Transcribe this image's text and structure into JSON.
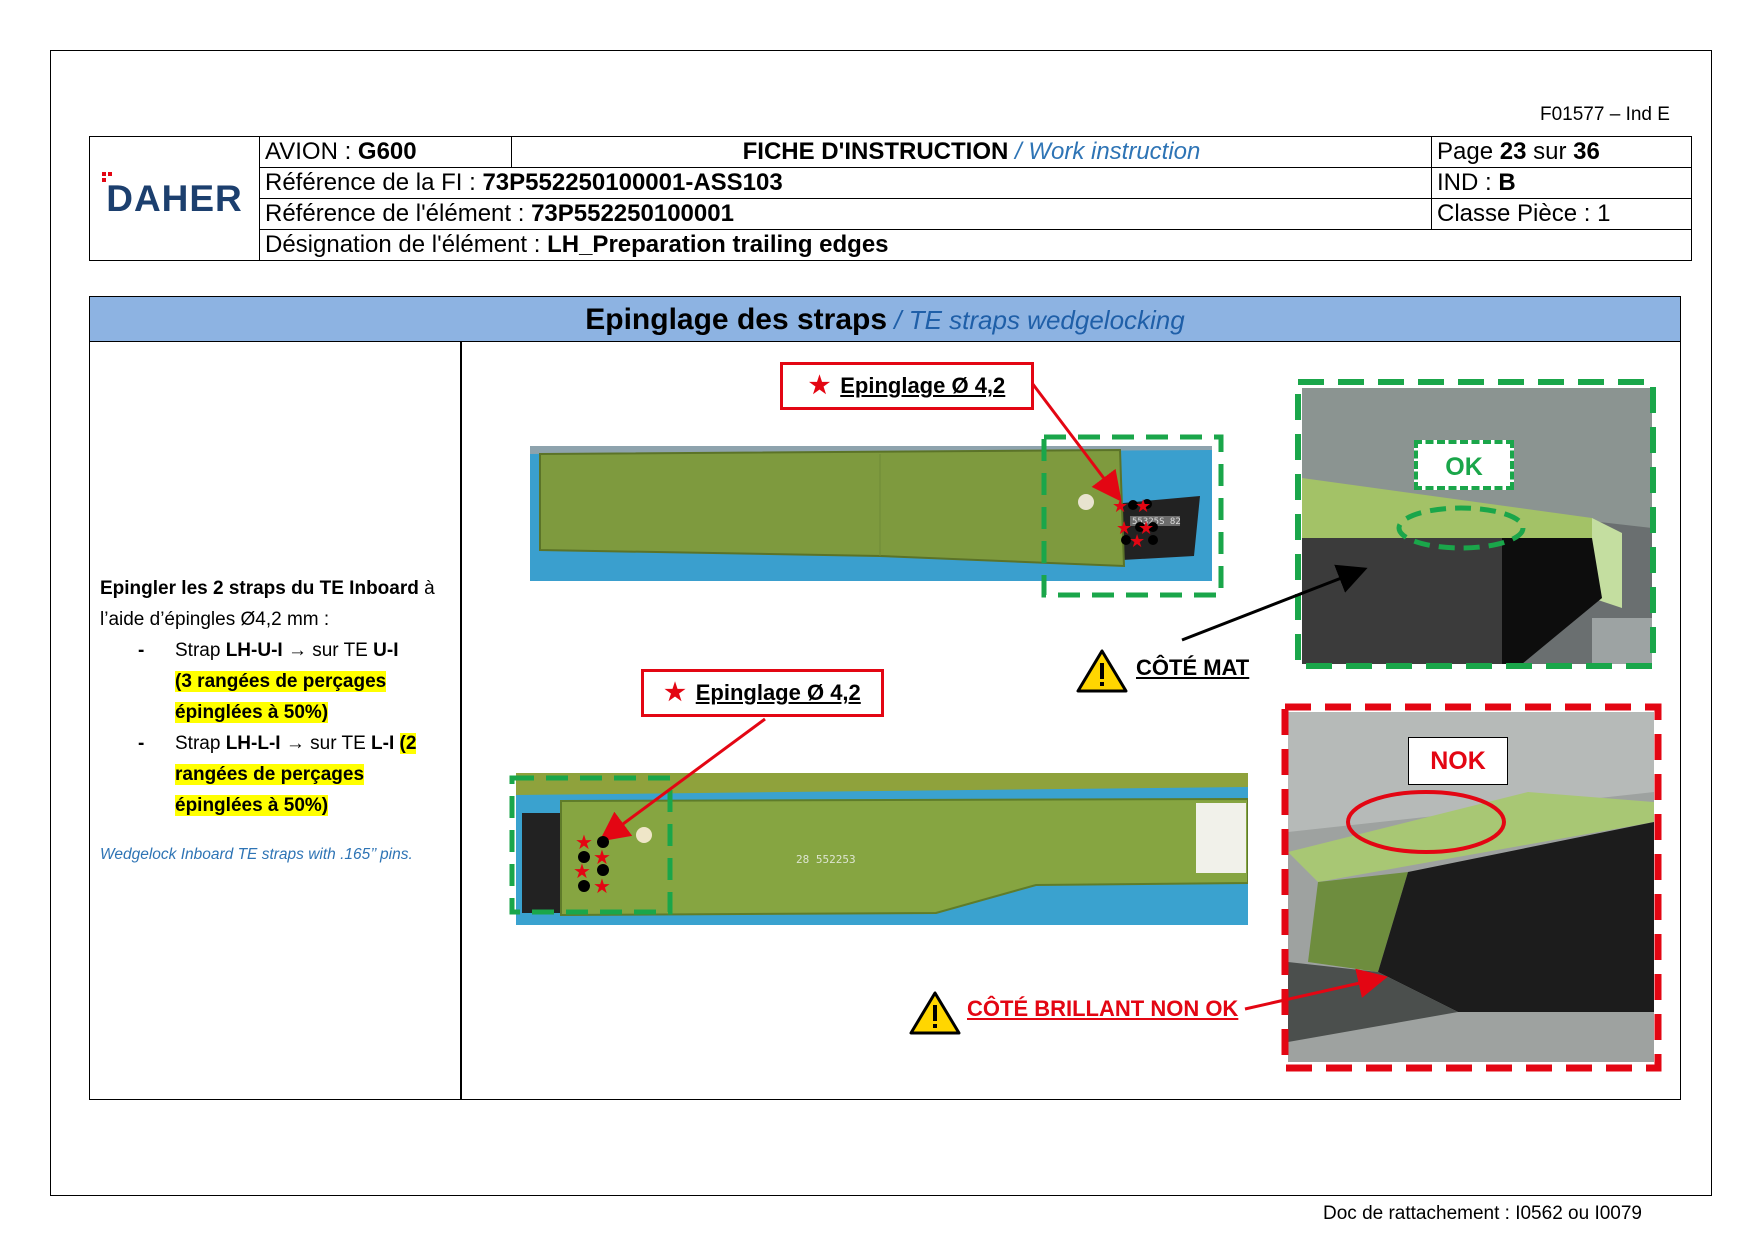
{
  "doc_code": "F01577 – Ind E",
  "header": {
    "logo_text": "DAHER",
    "avion_label": "AVION : ",
    "avion_value": "G600",
    "fiche_label": "FICHE D'INSTRUCTION",
    "fiche_sub": " / Work instruction",
    "page_prefix": "Page ",
    "page_num": "23",
    "page_mid": " sur ",
    "page_total": "36",
    "ref_fi_label": "Référence de la FI : ",
    "ref_fi_value": "73P552250100001-ASS103",
    "ind_label": "IND : ",
    "ind_value": "B",
    "ref_elem_label": "Référence de l'élément : ",
    "ref_elem_value": "73P552250100001",
    "classe_label": "Classe Pièce : 1",
    "design_label": "Désignation de l'élément : ",
    "design_value": "LH_Preparation trailing edges"
  },
  "section": {
    "title": "Epinglage des straps",
    "subtitle": " / TE straps wedgelocking"
  },
  "instructions": {
    "intro_bold": "Epingler les 2 straps du TE Inboard",
    "intro_rest": " à l’aide d’épingles Ø4,2 mm :",
    "items": [
      {
        "pre": "Strap ",
        "strap": "LH-U-I",
        "mid": " → sur TE ",
        "te": "U-I",
        "sp": " ",
        "note": "(3 rangées de perçages épinglées à 50%)"
      },
      {
        "pre": "Strap ",
        "strap": "LH-L-I",
        "mid": " → sur TE ",
        "te": "L-I",
        "sp": " ",
        "note": "(2 rangées de perçages épinglées à 50%)"
      }
    ],
    "english": "Wedgelock Inboard TE straps with .165’’ pins."
  },
  "figures": {
    "label_top": "Epinglage Ø 4,2",
    "label_bottom": "Epinglage Ø 4,2",
    "ok": "OK",
    "nok": "NOK",
    "cote_mat": "CÔTÉ MAT",
    "cote_brillant": "CÔTÉ BRILLANT NON OK",
    "strap_marking_top": "55325S 82",
    "strap_marking_bottom": "28 552253"
  },
  "colors": {
    "band": "#8db3e2",
    "accent_red": "#e30613",
    "accent_green": "#1aa64a",
    "highlight": "#ffff00",
    "blue_text": "#2e74b5"
  },
  "footer": "Doc de rattachement : I0562 ou I0079"
}
